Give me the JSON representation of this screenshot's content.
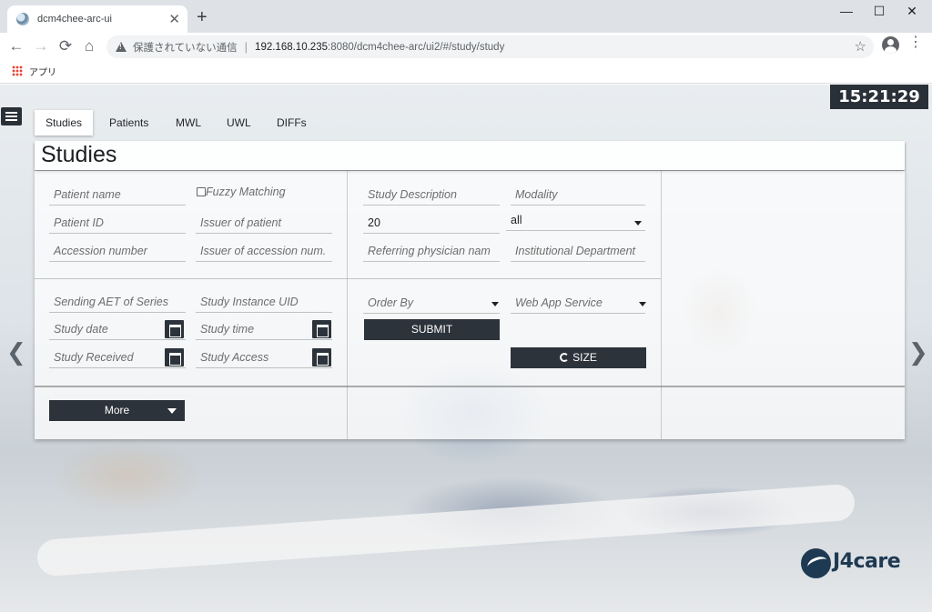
{
  "browser": {
    "tab_title": "dcm4chee-arc-ui",
    "tab_close": "✕",
    "new_tab": "+",
    "window_controls": {
      "minimize": "—",
      "maximize": "☐",
      "close": "✕"
    },
    "nav": {
      "back": "←",
      "forward": "→",
      "reload": "⟳",
      "home": "⌂"
    },
    "security_text": "保護されていない通信",
    "url_host": "192.168.10.235",
    "url_rest": ":8080/dcm4chee-arc/ui2/#/study/study",
    "bookmark_star": "☆",
    "menu": "⋮",
    "bookmarks_apps": "アプリ"
  },
  "app": {
    "clock": "15:21:29",
    "tabs": [
      "Studies",
      "Patients",
      "MWL",
      "UWL",
      "DIFFs"
    ],
    "active_tab": "Studies",
    "page_title": "Studies",
    "logo_text": "J4care",
    "arrow_left": "❮",
    "arrow_right": "❯"
  },
  "filters": {
    "patient_name": "Patient name",
    "fuzzy_matching": "Fuzzy Matching",
    "patient_id": "Patient ID",
    "issuer_of_patient": "Issuer of patient",
    "accession_number": "Accession number",
    "issuer_of_accession": "Issuer of accession num.",
    "study_description": "Study Description",
    "modality": "Modality",
    "limit_value": "20",
    "modality_selected": "all",
    "referring_physician": "Referring physician nam",
    "institutional_department": "Institutional Department",
    "sending_aet": "Sending AET of Series",
    "study_instance_uid": "Study Instance UID",
    "study_date": "Study date",
    "study_time": "Study time",
    "study_received": "Study Received",
    "study_access": "Study Access",
    "order_by": "Order By",
    "web_app_service": "Web App Service",
    "submit": "SUBMIT",
    "size": "SIZE",
    "more": "More"
  }
}
